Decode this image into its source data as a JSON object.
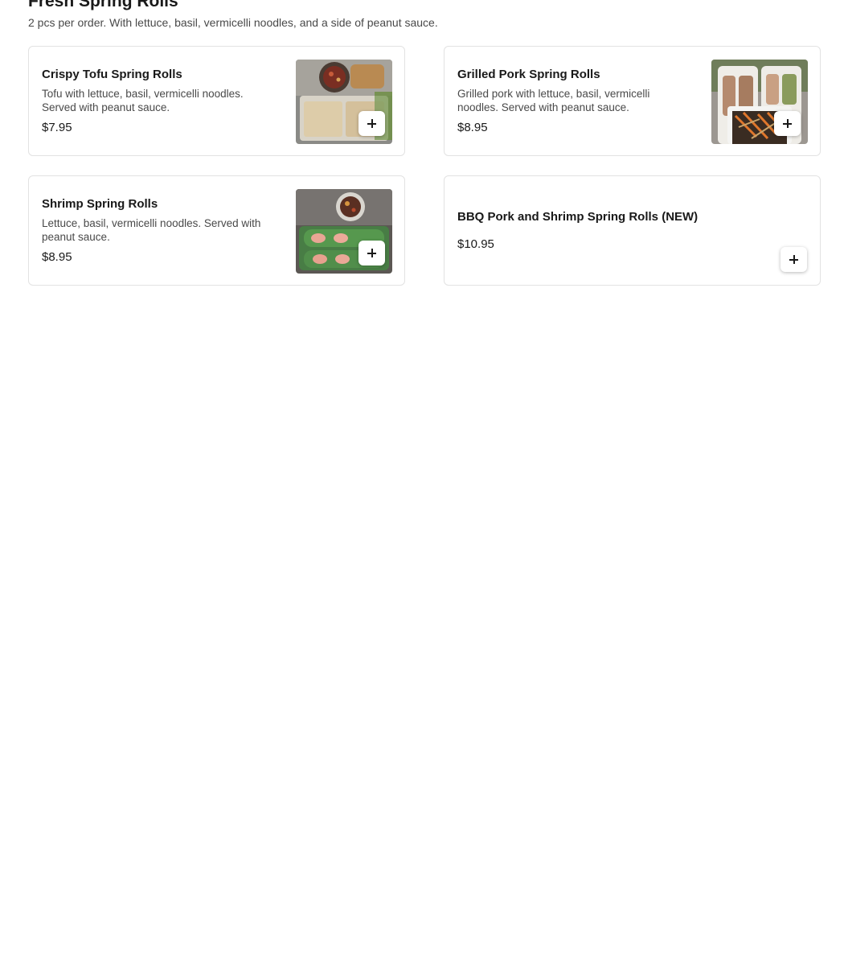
{
  "section": {
    "title": "Fresh Spring Rolls",
    "description": "2 pcs per order. With lettuce, basil, vermicelli noodles, and a side of peanut sauce."
  },
  "items": [
    {
      "name": "Crispy Tofu Spring Rolls",
      "description": "Tofu with lettuce, basil, vermicelli noodles. Served with peanut sauce.",
      "price": "$7.95",
      "has_image": true,
      "add_icon": "plus-icon"
    },
    {
      "name": "Grilled Pork Spring Rolls",
      "description": "Grilled pork with lettuce, basil, vermicelli noodles. Served with peanut sauce.",
      "price": "$8.95",
      "has_image": true,
      "add_icon": "plus-icon"
    },
    {
      "name": "Shrimp Spring Rolls",
      "description": "Lettuce, basil, vermicelli noodles. Served with peanut sauce.",
      "price": "$8.95",
      "has_image": true,
      "add_icon": "plus-icon"
    },
    {
      "name": "BBQ Pork and Shrimp Spring Rolls (NEW)",
      "description": "",
      "price": "$10.95",
      "has_image": false,
      "add_icon": "plus-icon"
    }
  ],
  "colors": {
    "text_primary": "#191919",
    "text_secondary": "#494949",
    "card_border": "#e2e2e2",
    "background": "#ffffff"
  }
}
